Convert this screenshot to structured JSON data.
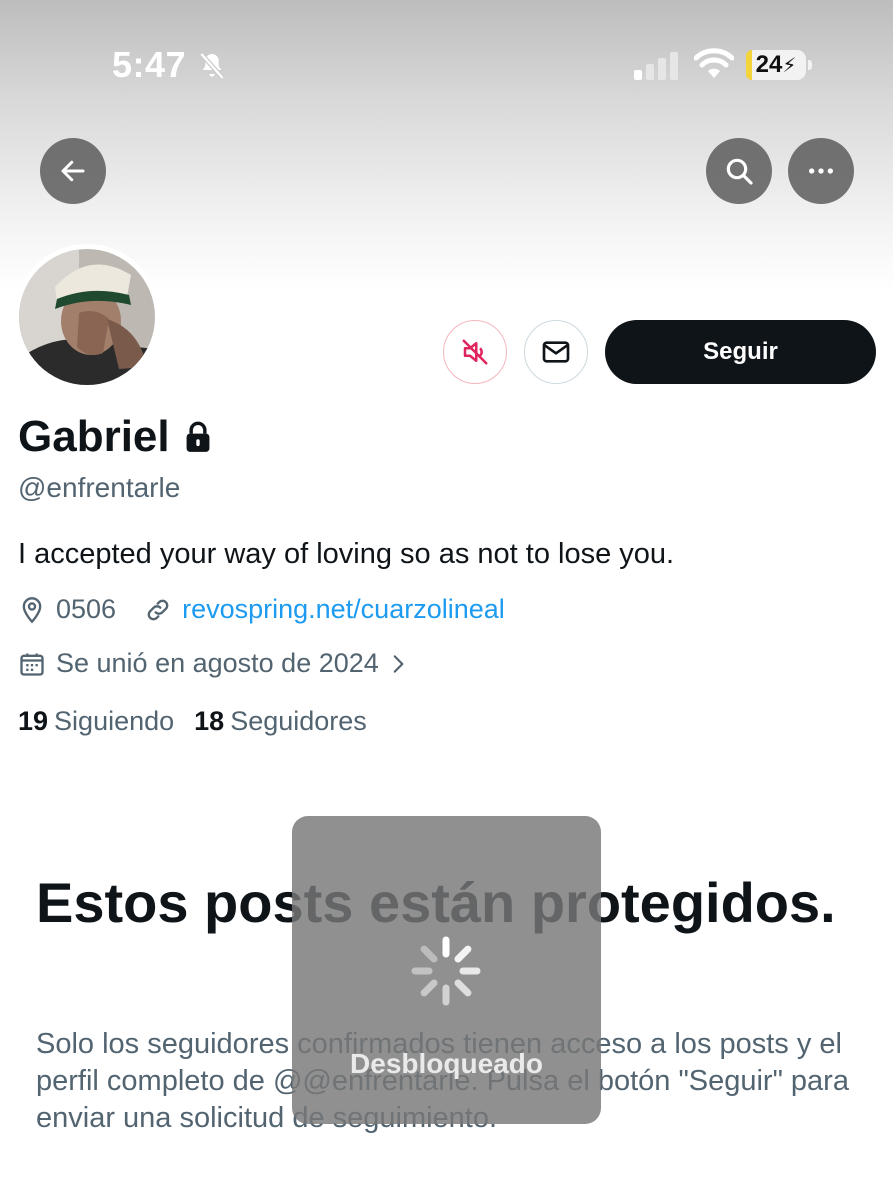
{
  "status_bar": {
    "time": "5:47",
    "battery": "24",
    "icons": [
      "bell-slash-icon",
      "cellular-signal-icon",
      "wifi-icon",
      "battery-charging-icon"
    ]
  },
  "nav": {
    "icons": [
      "arrow-left-icon",
      "search-icon",
      "ellipsis-icon"
    ]
  },
  "profile": {
    "display_name": "Gabriel",
    "handle": "@enfrentarle",
    "bio": "I accepted your way of loving so as not to lose you.",
    "location": "0506",
    "website": "revospring.net/cuarzolineal",
    "joined": "Se unió en agosto de 2024",
    "following_count": "19",
    "following_label": "Siguiendo",
    "followers_count": "18",
    "followers_label": "Seguidores"
  },
  "actions": {
    "follow_label": "Seguir",
    "icons": [
      "speaker-muted-icon",
      "envelope-icon"
    ]
  },
  "protected": {
    "title": "Estos posts están protegidos.",
    "text": "Solo los seguidores confirmados tienen acceso a los posts y el perfil completo de @@enfrentarle. Pulsa el botón \"Seguir\" para enviar una solicitud de seguimiento."
  },
  "hud": {
    "label": "Desbloqueado"
  },
  "colors": {
    "link": "#1d9bf0",
    "muted_red": "#e0245e",
    "text_secondary": "#536471",
    "button_dark": "#0f1419"
  }
}
